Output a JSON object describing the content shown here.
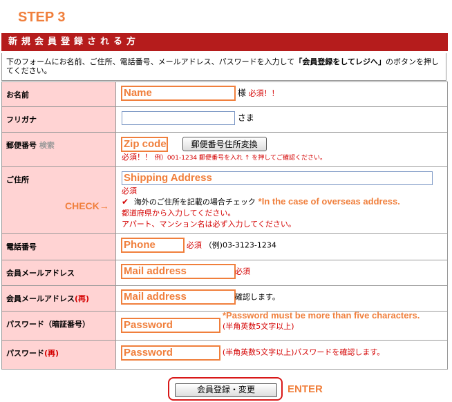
{
  "step_label": "STEP 3",
  "section_title": "新規会員登録される方",
  "intro": {
    "part1": "下のフォームにお名前、ご住所、電話番号、メールアドレス、パスワードを入力して",
    "emph": "「会員登録をしてレジへ」",
    "part2": "のボタンを押してください。"
  },
  "rows": {
    "name": {
      "label": "お名前",
      "value": "Name",
      "suffix": "様",
      "required": "必須！！"
    },
    "furigana": {
      "label": "フリガナ",
      "value": "",
      "suffix": "さま"
    },
    "zip": {
      "label": "郵便番号",
      "search": "検索",
      "value": "Zip code",
      "button": "郵便番号住所変換",
      "required": "必須！！",
      "hint": "例）001-1234 郵便番号を入れ ↑ を押してご確認ください。"
    },
    "address": {
      "label": "ご住所",
      "value": "Shipping Address",
      "required": "必須",
      "overseas_label": "海外のご住所を記載の場合チェック",
      "overseas_note": "*In the case of overseas address.",
      "line1": "都道府県から入力してください。",
      "line2": "アパート、マンション名は必ず入力してください。"
    },
    "phone": {
      "label": "電話番号",
      "value": "Phone",
      "required": "必須",
      "example": "（例)03-3123-1234"
    },
    "email": {
      "label": "会員メールアドレス",
      "value": "Mail address",
      "required": "必須"
    },
    "email_confirm": {
      "label": "会員メールアドレス",
      "label_suffix": "(再)",
      "value": "Mail address",
      "note": "確認します。"
    },
    "password": {
      "label": "パスワード（暗証番号）",
      "value": "Password",
      "note": "*Password must be more than five characters.",
      "hint": "(半角英数5文字以上)"
    },
    "password_confirm": {
      "label": "パスワード",
      "label_suffix": "(再)",
      "value": "Password",
      "hint": "(半角英数5文字以上)パスワードを確認します。"
    }
  },
  "check_label": "CHECK→",
  "submit_label": "会員登録・変更",
  "enter_label": "ENTER",
  "colors": {
    "accent": "#f07f3c",
    "header": "#b51c1c",
    "label_bg": "#ffd3d3",
    "required": "#d40000"
  }
}
